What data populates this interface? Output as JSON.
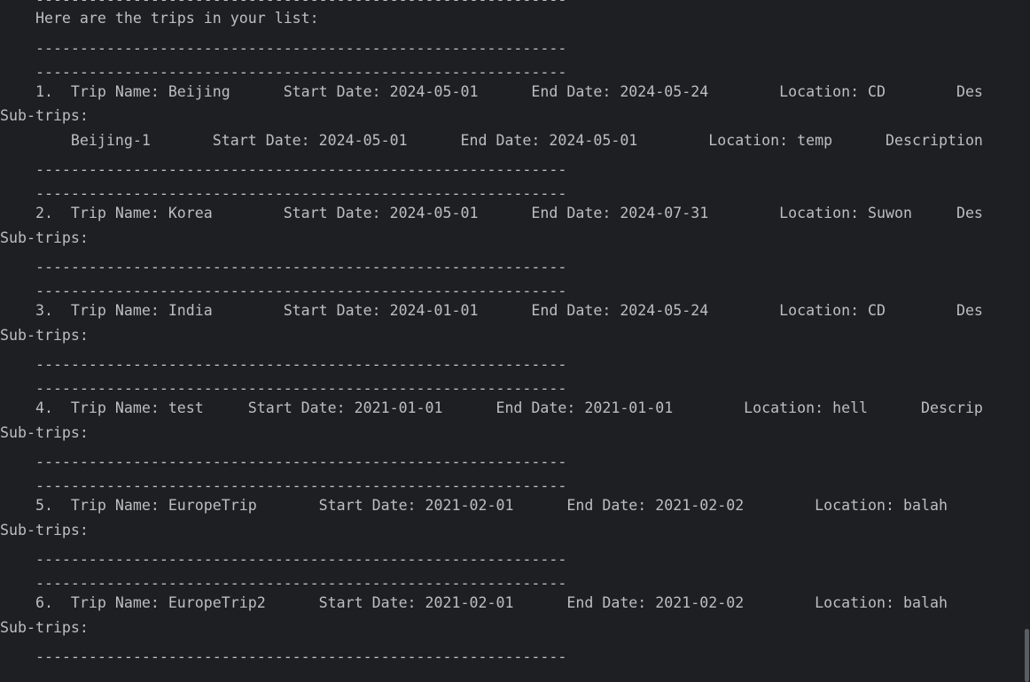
{
  "console": {
    "separator": "------------------------------------------------------------",
    "header": "    Here are the trips in your list:",
    "lines": [
      "    ------------------------------------------------------------",
      "    Here are the trips in your list:",
      "    ------------------------------------------------------------",
      "    ------------------------------------------------------------",
      "    1.  Trip Name: Beijing      Start Date: 2024-05-01      End Date: 2024-05-24        Location: CD        Des",
      "Sub-trips:",
      "        Beijing-1       Start Date: 2024-05-01      End Date: 2024-05-01        Location: temp      Description",
      "    ------------------------------------------------------------",
      "    ------------------------------------------------------------",
      "    2.  Trip Name: Korea        Start Date: 2024-05-01      End Date: 2024-07-31        Location: Suwon     Des",
      "Sub-trips:",
      "    ------------------------------------------------------------",
      "    ------------------------------------------------------------",
      "    3.  Trip Name: India        Start Date: 2024-01-01      End Date: 2024-05-24        Location: CD        Des",
      "Sub-trips:",
      "    ------------------------------------------------------------",
      "    ------------------------------------------------------------",
      "    4.  Trip Name: test     Start Date: 2021-01-01      End Date: 2021-01-01        Location: hell      Descrip",
      "Sub-trips:",
      "    ------------------------------------------------------------",
      "    ------------------------------------------------------------",
      "    5.  Trip Name: EuropeTrip       Start Date: 2021-02-01      End Date: 2021-02-02        Location: balah",
      "Sub-trips:",
      "    ------------------------------------------------------------",
      "    ------------------------------------------------------------",
      "    6.  Trip Name: EuropeTrip2      Start Date: 2021-02-01      End Date: 2021-02-02        Location: balah",
      "Sub-trips:",
      "    ------------------------------------------------------------"
    ]
  }
}
